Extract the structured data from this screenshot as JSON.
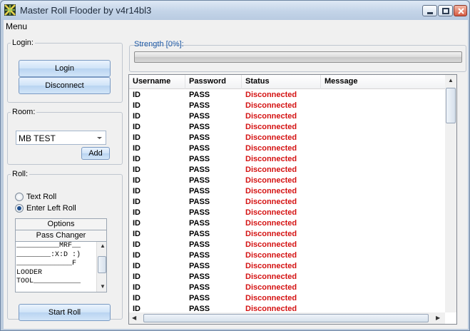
{
  "window": {
    "title": "Master Roll Flooder by v4r14bl3"
  },
  "menu": {
    "items": [
      "Menu"
    ]
  },
  "login_group": {
    "legend": "Login:",
    "login_button": "Login",
    "disconnect_button": "Disconnect"
  },
  "room_group": {
    "legend": "Room:",
    "selected_room": "MB TEST",
    "add_button": "Add"
  },
  "roll_group": {
    "legend": "Roll:",
    "radio_text_roll": "Text Roll",
    "radio_enter_left_roll": "Enter Left Roll",
    "selected_mode": "Enter Left Roll",
    "options_header": "Options",
    "pass_changer_header": "Pass Changer",
    "list_lines": [
      "__________MRF__",
      "________:X:D :)",
      "_____________F",
      "LOODER",
      "TOOL___________"
    ],
    "start_button": "Start Roll"
  },
  "strength": {
    "label": "Strength [0%]:",
    "progress_percent": 0
  },
  "accounts_list": {
    "columns": [
      "Username",
      "Password",
      "Status",
      "Message"
    ],
    "rows": [
      {
        "username": "ID",
        "password": "PASS",
        "status": "Disconnected",
        "message": ""
      },
      {
        "username": "ID",
        "password": "PASS",
        "status": "Disconnected",
        "message": ""
      },
      {
        "username": "ID",
        "password": "PASS",
        "status": "Disconnected",
        "message": ""
      },
      {
        "username": "ID",
        "password": "PASS",
        "status": "Disconnected",
        "message": ""
      },
      {
        "username": "ID",
        "password": "PASS",
        "status": "Disconnected",
        "message": ""
      },
      {
        "username": "ID",
        "password": "PASS",
        "status": "Disconnected",
        "message": ""
      },
      {
        "username": "ID",
        "password": "PASS",
        "status": "Disconnected",
        "message": ""
      },
      {
        "username": "ID",
        "password": "PASS",
        "status": "Disconnected",
        "message": ""
      },
      {
        "username": "ID",
        "password": "PASS",
        "status": "Disconnected",
        "message": ""
      },
      {
        "username": "ID",
        "password": "PASS",
        "status": "Disconnected",
        "message": ""
      },
      {
        "username": "ID",
        "password": "PASS",
        "status": "Disconnected",
        "message": ""
      },
      {
        "username": "ID",
        "password": "PASS",
        "status": "Disconnected",
        "message": ""
      },
      {
        "username": "ID",
        "password": "PASS",
        "status": "Disconnected",
        "message": ""
      },
      {
        "username": "ID",
        "password": "PASS",
        "status": "Disconnected",
        "message": ""
      },
      {
        "username": "ID",
        "password": "PASS",
        "status": "Disconnected",
        "message": ""
      },
      {
        "username": "ID",
        "password": "PASS",
        "status": "Disconnected",
        "message": ""
      },
      {
        "username": "ID",
        "password": "PASS",
        "status": "Disconnected",
        "message": ""
      },
      {
        "username": "ID",
        "password": "PASS",
        "status": "Disconnected",
        "message": ""
      },
      {
        "username": "ID",
        "password": "PASS",
        "status": "Disconnected",
        "message": ""
      },
      {
        "username": "ID",
        "password": "PASS",
        "status": "Disconnected",
        "message": ""
      },
      {
        "username": "ID",
        "password": "PASS",
        "status": "Disconnected",
        "message": ""
      }
    ]
  },
  "colors": {
    "status_disconnected": "#d41212",
    "strength_label": "#1f5aa6"
  },
  "icons": {
    "app": "app-logo-icon",
    "minimize": "minimize-icon",
    "maximize": "maximize-icon",
    "close": "close-icon",
    "combo_arrow": "chevron-down-icon"
  }
}
